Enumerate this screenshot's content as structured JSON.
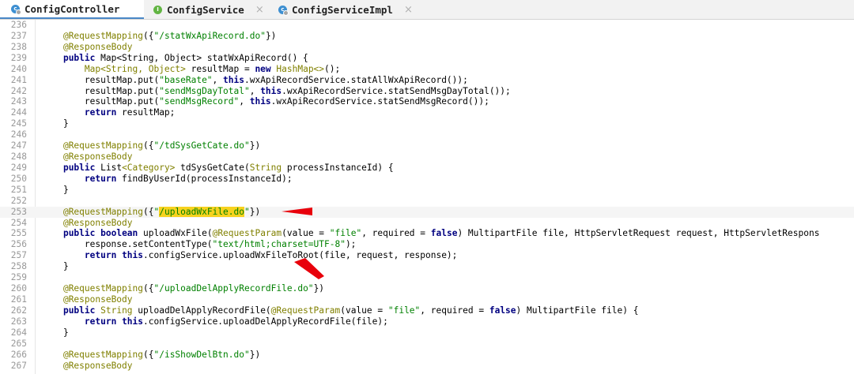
{
  "tabs": [
    {
      "label": "ConfigController",
      "icon": "class-icon",
      "active": true
    },
    {
      "label": "ConfigService",
      "icon": "interface-icon",
      "active": false
    },
    {
      "label": "ConfigServiceImpl",
      "icon": "class-icon",
      "active": false
    }
  ],
  "tab_close_glyph": "×",
  "colors": {
    "annotation": "#808000",
    "string": "#008000",
    "keyword": "#000080",
    "highlight": "#f7d21e",
    "arrow": "#e8000b"
  },
  "lines": [
    {
      "num": "236",
      "tokens": []
    },
    {
      "num": "237",
      "tokens": [
        {
          "t": "    "
        },
        {
          "t": "@RequestMapping",
          "c": "ann"
        },
        {
          "t": "({"
        },
        {
          "t": "\"/statWxApiRecord.do\"",
          "c": "str"
        },
        {
          "t": "})"
        }
      ]
    },
    {
      "num": "238",
      "tokens": [
        {
          "t": "    "
        },
        {
          "t": "@ResponseBody",
          "c": "ann"
        }
      ]
    },
    {
      "num": "239",
      "tokens": [
        {
          "t": "    "
        },
        {
          "t": "public",
          "c": "kw"
        },
        {
          "t": " Map<String, Object> statWxApiRecord() {"
        }
      ]
    },
    {
      "num": "240",
      "tokens": [
        {
          "t": "        "
        },
        {
          "t": "Map<String, Object>",
          "c": "ann"
        },
        {
          "t": " resultMap = "
        },
        {
          "t": "new",
          "c": "kw"
        },
        {
          "t": " "
        },
        {
          "t": "HashMap<>",
          "c": "ann"
        },
        {
          "t": "();"
        }
      ]
    },
    {
      "num": "241",
      "tokens": [
        {
          "t": "        resultMap.put("
        },
        {
          "t": "\"baseRate\"",
          "c": "str"
        },
        {
          "t": ", "
        },
        {
          "t": "this",
          "c": "kw"
        },
        {
          "t": ".wxApiRecordService.statAllWxApiRecord());"
        }
      ]
    },
    {
      "num": "242",
      "tokens": [
        {
          "t": "        resultMap.put("
        },
        {
          "t": "\"sendMsgDayTotal\"",
          "c": "str"
        },
        {
          "t": ", "
        },
        {
          "t": "this",
          "c": "kw"
        },
        {
          "t": ".wxApiRecordService.statSendMsgDayTotal());"
        }
      ]
    },
    {
      "num": "243",
      "tokens": [
        {
          "t": "        resultMap.put("
        },
        {
          "t": "\"sendMsgRecord\"",
          "c": "str"
        },
        {
          "t": ", "
        },
        {
          "t": "this",
          "c": "kw"
        },
        {
          "t": ".wxApiRecordService.statSendMsgRecord());"
        }
      ]
    },
    {
      "num": "244",
      "tokens": [
        {
          "t": "        "
        },
        {
          "t": "return",
          "c": "kw"
        },
        {
          "t": " resultMap;"
        }
      ]
    },
    {
      "num": "245",
      "tokens": [
        {
          "t": "    }"
        }
      ]
    },
    {
      "num": "246",
      "tokens": []
    },
    {
      "num": "247",
      "tokens": [
        {
          "t": "    "
        },
        {
          "t": "@RequestMapping",
          "c": "ann"
        },
        {
          "t": "({"
        },
        {
          "t": "\"/tdSysGetCate.do\"",
          "c": "str"
        },
        {
          "t": "})"
        }
      ]
    },
    {
      "num": "248",
      "tokens": [
        {
          "t": "    "
        },
        {
          "t": "@ResponseBody",
          "c": "ann"
        }
      ]
    },
    {
      "num": "249",
      "tokens": [
        {
          "t": "    "
        },
        {
          "t": "public",
          "c": "kw"
        },
        {
          "t": " List"
        },
        {
          "t": "<Category>",
          "c": "ann"
        },
        {
          "t": " tdSysGetCate("
        },
        {
          "t": "String",
          "c": "ann"
        },
        {
          "t": " processInstanceId) {"
        }
      ]
    },
    {
      "num": "250",
      "tokens": [
        {
          "t": "        "
        },
        {
          "t": "return",
          "c": "kw"
        },
        {
          "t": " findByUserId(processInstanceId);"
        }
      ]
    },
    {
      "num": "251",
      "tokens": [
        {
          "t": "    }"
        }
      ]
    },
    {
      "num": "252",
      "tokens": []
    },
    {
      "num": "253",
      "highlight": true,
      "tokens": [
        {
          "t": "    "
        },
        {
          "t": "@RequestMapping",
          "c": "ann"
        },
        {
          "t": "({"
        },
        {
          "t": "\"",
          "c": "str"
        },
        {
          "t": "/uploadWxFile.do",
          "c": "hl"
        },
        {
          "t": "\"",
          "c": "str"
        },
        {
          "t": "})"
        }
      ]
    },
    {
      "num": "254",
      "tokens": [
        {
          "t": "    "
        },
        {
          "t": "@ResponseBody",
          "c": "ann"
        }
      ]
    },
    {
      "num": "255",
      "tokens": [
        {
          "t": "    "
        },
        {
          "t": "public",
          "c": "kw"
        },
        {
          "t": " "
        },
        {
          "t": "boolean",
          "c": "kw"
        },
        {
          "t": " uploadWxFile("
        },
        {
          "t": "@RequestParam",
          "c": "ann"
        },
        {
          "t": "(value = "
        },
        {
          "t": "\"file\"",
          "c": "str"
        },
        {
          "t": ", required = "
        },
        {
          "t": "false",
          "c": "kw"
        },
        {
          "t": ") MultipartFile file, HttpServletRequest request, HttpServletRespons"
        }
      ]
    },
    {
      "num": "256",
      "tokens": [
        {
          "t": "        response.setContentType("
        },
        {
          "t": "\"text/html;charset=UTF-8\"",
          "c": "str"
        },
        {
          "t": ");"
        }
      ]
    },
    {
      "num": "257",
      "tokens": [
        {
          "t": "        "
        },
        {
          "t": "return",
          "c": "kw"
        },
        {
          "t": " "
        },
        {
          "t": "this",
          "c": "kw"
        },
        {
          "t": ".configService.uploadWxFileToRoot(file, request, response);"
        }
      ]
    },
    {
      "num": "258",
      "tokens": [
        {
          "t": "    }"
        }
      ]
    },
    {
      "num": "259",
      "tokens": []
    },
    {
      "num": "260",
      "tokens": [
        {
          "t": "    "
        },
        {
          "t": "@RequestMapping",
          "c": "ann"
        },
        {
          "t": "({"
        },
        {
          "t": "\"/uploadDelApplyRecordFile.do\"",
          "c": "str"
        },
        {
          "t": "})"
        }
      ]
    },
    {
      "num": "261",
      "tokens": [
        {
          "t": "    "
        },
        {
          "t": "@ResponseBody",
          "c": "ann"
        }
      ]
    },
    {
      "num": "262",
      "tokens": [
        {
          "t": "    "
        },
        {
          "t": "public",
          "c": "kw"
        },
        {
          "t": " "
        },
        {
          "t": "String",
          "c": "ann"
        },
        {
          "t": " uploadDelApplyRecordFile("
        },
        {
          "t": "@RequestParam",
          "c": "ann"
        },
        {
          "t": "(value = "
        },
        {
          "t": "\"file\"",
          "c": "str"
        },
        {
          "t": ", required = "
        },
        {
          "t": "false",
          "c": "kw"
        },
        {
          "t": ") MultipartFile file) {"
        }
      ]
    },
    {
      "num": "263",
      "tokens": [
        {
          "t": "        "
        },
        {
          "t": "return",
          "c": "kw"
        },
        {
          "t": " "
        },
        {
          "t": "this",
          "c": "kw"
        },
        {
          "t": ".configService.uploadDelApplyRecordFile(file);"
        }
      ]
    },
    {
      "num": "264",
      "tokens": [
        {
          "t": "    }"
        }
      ]
    },
    {
      "num": "265",
      "tokens": []
    },
    {
      "num": "266",
      "tokens": [
        {
          "t": "    "
        },
        {
          "t": "@RequestMapping",
          "c": "ann"
        },
        {
          "t": "({"
        },
        {
          "t": "\"/isShowDelBtn.do\"",
          "c": "str"
        },
        {
          "t": "})"
        }
      ]
    },
    {
      "num": "267",
      "tokens": [
        {
          "t": "    "
        },
        {
          "t": "@ResponseBody",
          "c": "ann"
        }
      ]
    }
  ],
  "annotations": [
    {
      "type": "arrow",
      "label": "red-arrow-pointing-at-mapping"
    },
    {
      "type": "arrow",
      "label": "red-arrow-pointing-at-uploadWxFileToRoot"
    }
  ]
}
